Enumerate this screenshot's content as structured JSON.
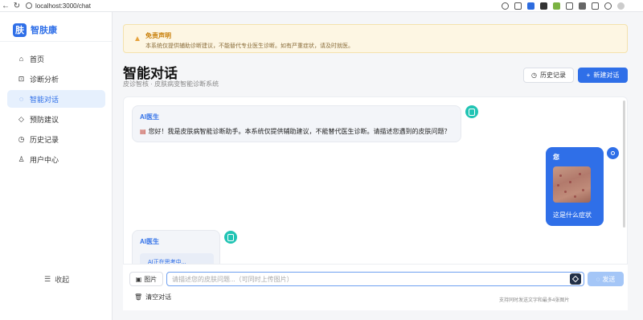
{
  "browser": {
    "url": "localhost:3000/chat",
    "back_icon": "back-arrow-icon",
    "reload_icon": "reload-icon"
  },
  "sidebar": {
    "logo_mark": "肤",
    "logo_text": "智肤康",
    "items": [
      {
        "label": "首页",
        "icon": "home-icon",
        "glyph": "⌂"
      },
      {
        "label": "诊断分析",
        "icon": "diagnosis-icon",
        "glyph": "⊡"
      },
      {
        "label": "智能对话",
        "icon": "chat-icon",
        "glyph": "◌"
      },
      {
        "label": "预防建议",
        "icon": "shield-icon",
        "glyph": "◇"
      },
      {
        "label": "历史记录",
        "icon": "clock-icon",
        "glyph": "◷"
      },
      {
        "label": "用户中心",
        "icon": "user-icon",
        "glyph": "♙"
      }
    ],
    "collapse_label": "收起"
  },
  "disclaimer": {
    "title": "免责声明",
    "body": "本系统仅提供辅助诊断建议，不能替代专业医生诊断。如有严重症状，请及时就医。"
  },
  "header": {
    "title": "智能对话",
    "subtitle": "皮诊智核 · 皮肤病变智能诊断系统",
    "history_label": "历史记录",
    "new_chat_label": "新建对话"
  },
  "chat": {
    "messages": [
      {
        "sender": "AI医生",
        "text": "您好！我是皮肤病智能诊断助手。本系统仅提供辅助建议，不能替代医生诊断。请描述您遇到的皮肤问题？"
      },
      {
        "sender": "您",
        "text": "这是什么症状"
      },
      {
        "sender": "AI医生",
        "text": "AI正在思考中..."
      }
    ]
  },
  "input": {
    "image_label": "图片",
    "placeholder": "请描述您的皮肤问题...（可同时上传图片）",
    "send_label": "发送",
    "clear_label": "清空对话",
    "hint": "支持同时发送文字和最多4张图片"
  },
  "colors": {
    "accent": "#2f6fe8",
    "ai_avatar": "#21c4b4",
    "warning": "#e6a23c"
  }
}
